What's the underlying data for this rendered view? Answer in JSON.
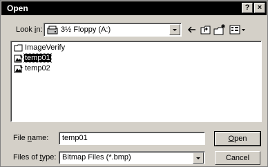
{
  "window": {
    "title": "Open",
    "help_label": "?",
    "close_label": "×"
  },
  "lookin": {
    "label_pre": "Look ",
    "label_accel": "i",
    "label_post": "n:",
    "value": "3½ Floppy (A:)",
    "icon": "floppy-drive-icon"
  },
  "toolbar": {
    "icons": [
      "back-arrow-icon",
      "up-folder-icon",
      "new-folder-icon",
      "view-menu-icon"
    ]
  },
  "files": [
    {
      "name": "ImageVerify",
      "icon": "folder-icon",
      "selected": false
    },
    {
      "name": "temp01",
      "icon": "bitmap-file-icon",
      "selected": true
    },
    {
      "name": "temp02",
      "icon": "bitmap-file-icon",
      "selected": false
    }
  ],
  "filename": {
    "label_pre": "File ",
    "label_accel": "n",
    "label_post": "ame:",
    "value": "temp01"
  },
  "filetype": {
    "label_pre": "Files of ",
    "label_accel": "t",
    "label_post": "ype:",
    "value": "Bitmap Files (*.bmp)"
  },
  "buttons": {
    "open_accel": "O",
    "open_rest": "pen",
    "cancel": "Cancel"
  },
  "colors": {
    "titlebar": "#000000",
    "dialog_face": "#d4d0c8",
    "selection": "#000000"
  }
}
